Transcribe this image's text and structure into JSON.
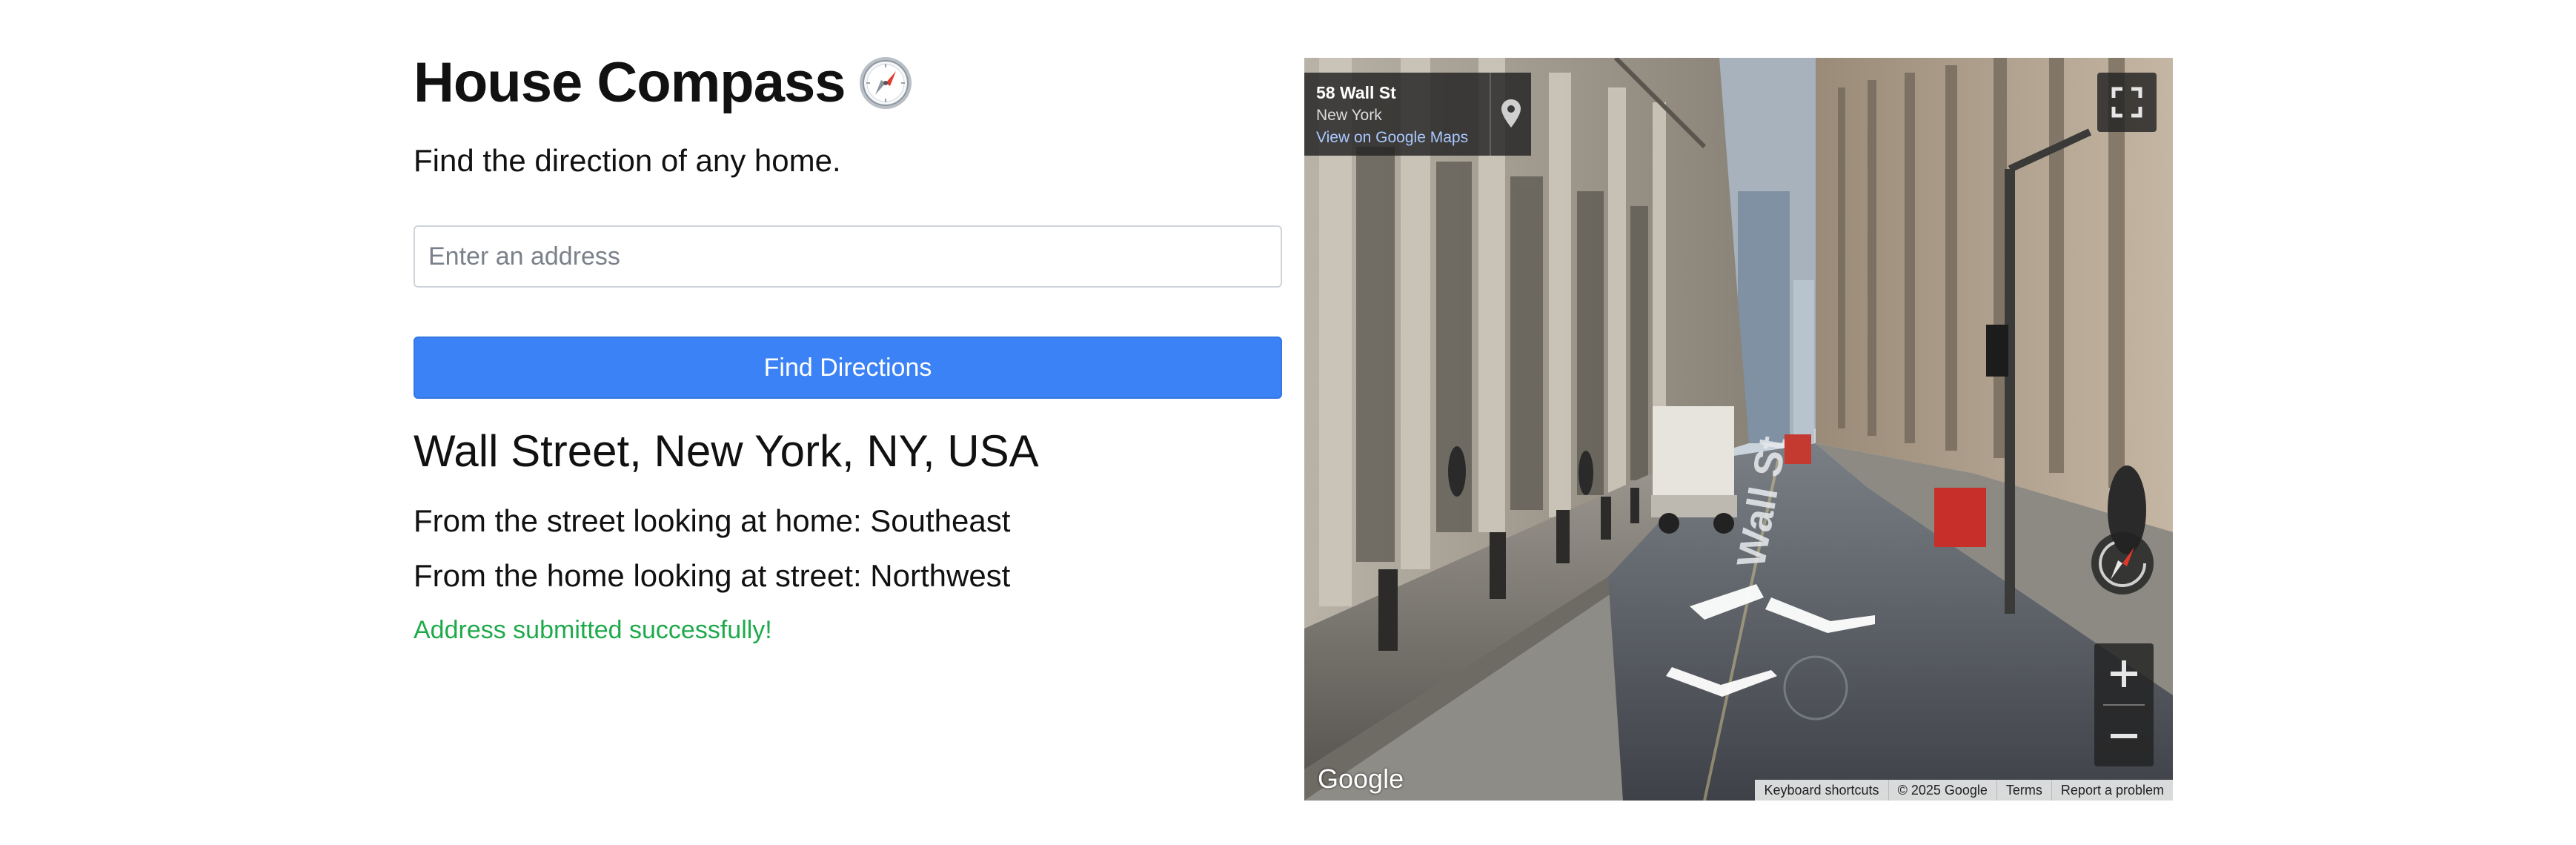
{
  "app": {
    "title": "House Compass",
    "title_emoji_icon": "compass-emoji-icon",
    "subtitle": "Find the direction of any home."
  },
  "form": {
    "address_value": "",
    "address_placeholder": "Enter an address",
    "submit_label": "Find Directions",
    "button_color": "#3b82f6"
  },
  "result": {
    "address": "Wall Street, New York, NY, USA",
    "street_to_home_label": "From the street looking at home: Southeast",
    "home_to_street_label": "From the home looking at street: Northwest",
    "status_message": "Address submitted successfully!",
    "status_color": "#1eaa4a"
  },
  "streetview": {
    "location_name": "58 Wall St",
    "location_city": "New York",
    "view_link": "View on Google Maps",
    "street_sign": "Wall St",
    "logo": "Google",
    "footer": [
      "Keyboard shortcuts",
      "© 2025 Google",
      "Terms",
      "Report a problem"
    ],
    "icons": [
      "map-pin-icon",
      "fullscreen-icon",
      "compass-control-icon",
      "zoom-in-icon",
      "zoom-out-icon",
      "navigation-arrow-icon"
    ]
  }
}
